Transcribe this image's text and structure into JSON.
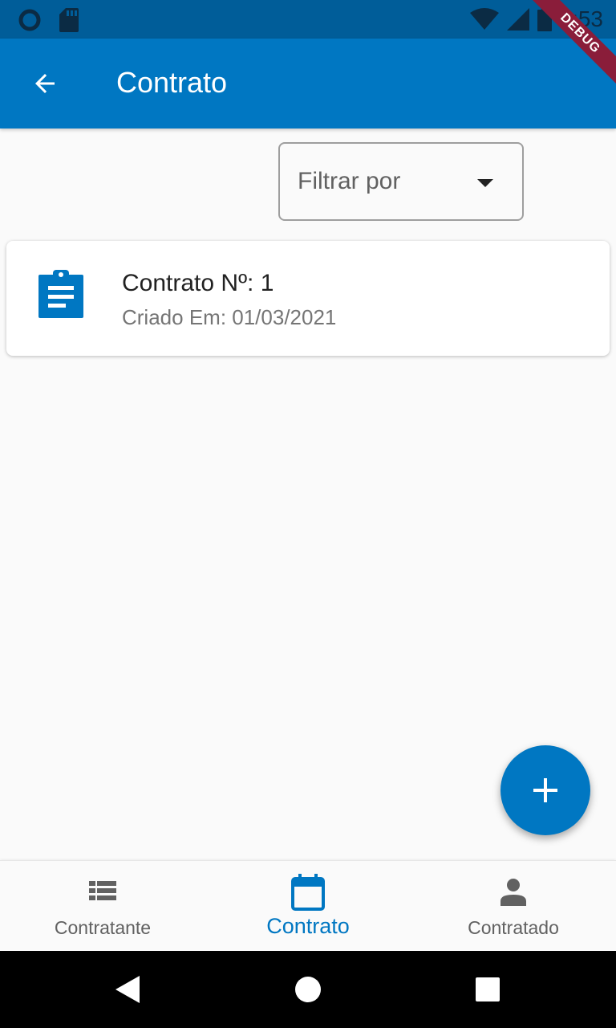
{
  "status_bar": {
    "time": "6:53",
    "icons": [
      "circle-notification-icon",
      "sd-card-icon",
      "wifi-icon",
      "signal-icon",
      "battery-icon"
    ]
  },
  "debug_banner": {
    "label": "DEBUG"
  },
  "app_bar": {
    "title": "Contrato",
    "back_icon": "arrow-back-icon",
    "color": "#0077c2"
  },
  "filter": {
    "placeholder": "Filtrar por"
  },
  "contracts": [
    {
      "title": "Contrato Nº: 1",
      "subtitle": "Criado Em: 01/03/2021",
      "icon": "assignment-icon"
    }
  ],
  "fab": {
    "icon": "add-icon"
  },
  "bottom_nav": {
    "items": [
      {
        "label": "Contratante",
        "icon": "list-icon",
        "active": false
      },
      {
        "label": "Contrato",
        "icon": "calendar-icon",
        "active": true
      },
      {
        "label": "Contratado",
        "icon": "person-icon",
        "active": false
      }
    ],
    "active_color": "#0077c2"
  },
  "system_nav": {
    "icons": [
      "back-triangle-icon",
      "home-circle-icon",
      "recents-square-icon"
    ]
  }
}
